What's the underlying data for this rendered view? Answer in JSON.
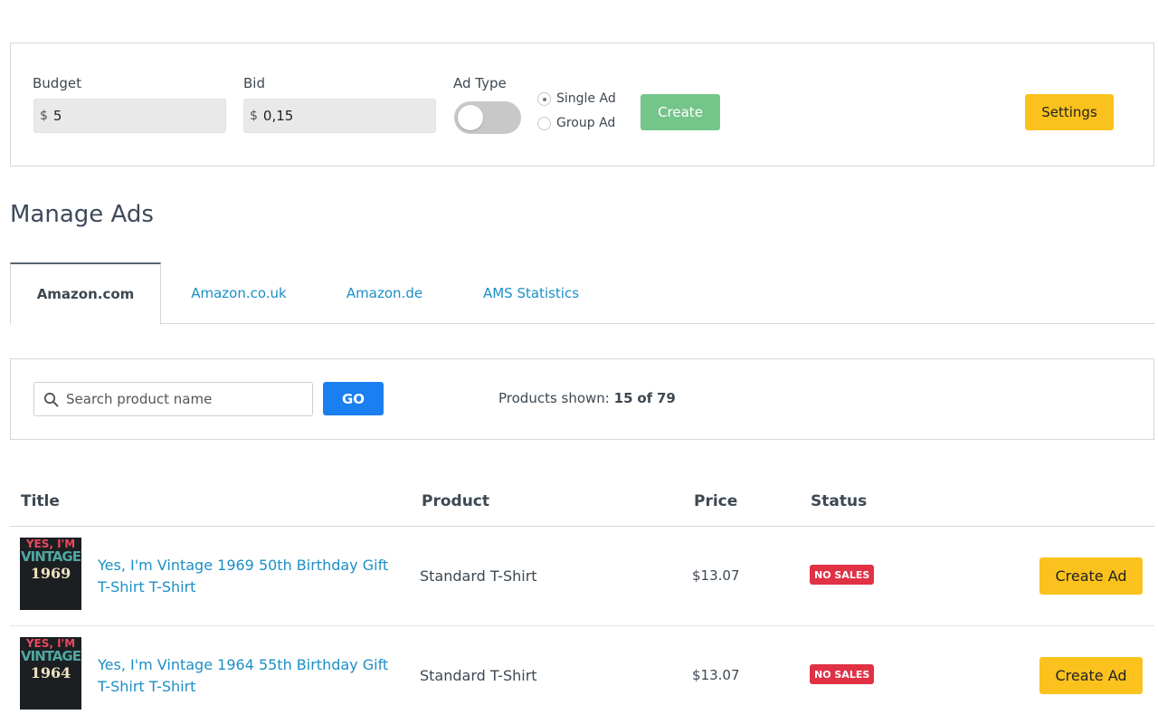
{
  "config": {
    "budget_label": "Budget",
    "budget_currency": "$",
    "budget_value": "5",
    "bid_label": "Bid",
    "bid_currency": "$",
    "bid_value": "0,15",
    "ad_type_label": "Ad Type",
    "ad_type_toggle_on": false,
    "single_ad_label": "Single Ad",
    "group_ad_label": "Group Ad",
    "selected_ad_type": "Single Ad",
    "create_label": "Create",
    "settings_label": "Settings"
  },
  "page_title": "Manage Ads",
  "tabs": [
    {
      "label": "Amazon.com",
      "active": true
    },
    {
      "label": "Amazon.co.uk",
      "active": false
    },
    {
      "label": "Amazon.de",
      "active": false
    },
    {
      "label": "AMS Statistics",
      "active": false
    }
  ],
  "search": {
    "placeholder": "Search product name",
    "go_label": "GO",
    "products_shown_prefix": "Products shown:",
    "shown": "15",
    "of_word": "of",
    "total": "79"
  },
  "table": {
    "headers": {
      "title": "Title",
      "product": "Product",
      "price": "Price",
      "status": "Status"
    },
    "rows": [
      {
        "thumb_line1": "YES, I'M",
        "thumb_line2": "VINTAGE",
        "thumb_line3": "1969",
        "title": "Yes, I'm Vintage 1969 50th Birthday Gift T-Shirt T-Shirt",
        "product": "Standard T-Shirt",
        "price": "$13.07",
        "status": "NO SALES",
        "action": "Create Ad"
      },
      {
        "thumb_line1": "YES, I'M",
        "thumb_line2": "VINTAGE",
        "thumb_line3": "1964",
        "title": "Yes, I'm Vintage 1964 55th Birthday Gift T-Shirt T-Shirt",
        "product": "Standard T-Shirt",
        "price": "$13.07",
        "status": "NO SALES",
        "action": "Create Ad"
      }
    ]
  },
  "colors": {
    "accent_yellow": "#fbc21d",
    "create_green": "#74c58a",
    "go_blue": "#1a7ff0",
    "link_blue": "#1c8fc6",
    "badge_red": "#e03145"
  }
}
